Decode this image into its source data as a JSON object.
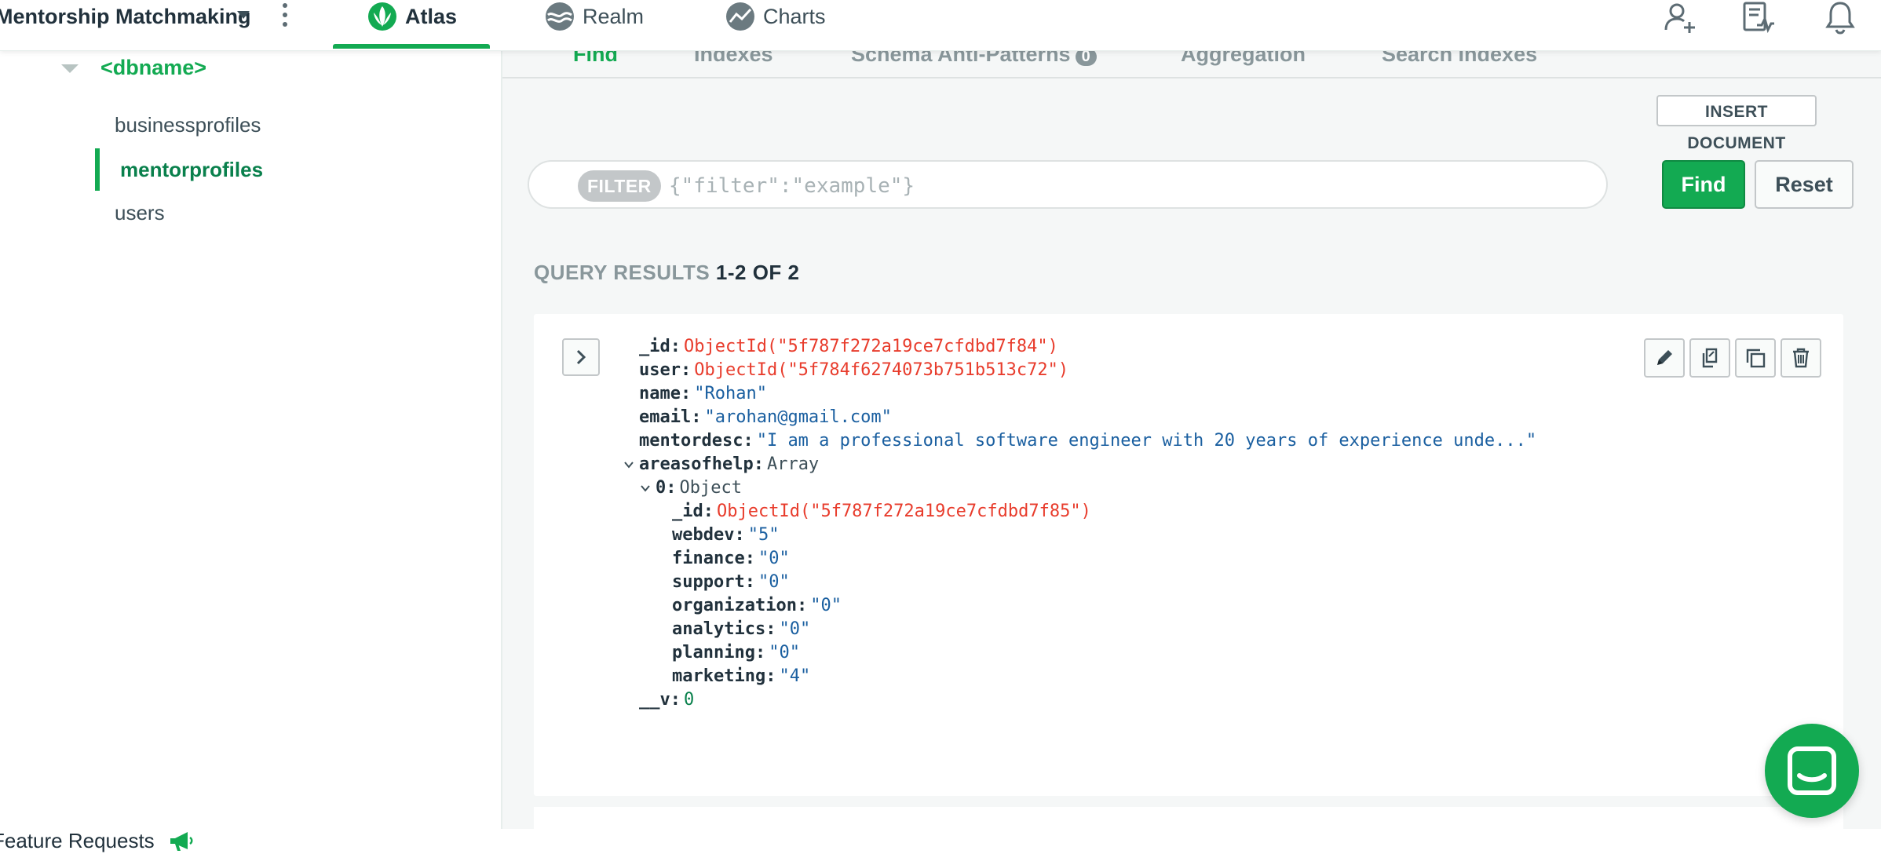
{
  "topbar": {
    "project_name": "Mentorship Matchmaking",
    "tabs": [
      {
        "label": "Atlas",
        "icon": "atlas-leaf-icon"
      },
      {
        "label": "Realm",
        "icon": "realm-icon"
      },
      {
        "label": "Charts",
        "icon": "charts-icon"
      }
    ],
    "icons": [
      "add-user-icon",
      "activity-feed-icon",
      "bell-icon"
    ],
    "accent": "#13aa52"
  },
  "sidebar": {
    "db_name": "<dbname>",
    "collections": [
      "businessprofiles",
      "mentorprofiles",
      "users"
    ],
    "active_collection": "mentorprofiles",
    "feature_requests": "Feature Requests"
  },
  "main": {
    "subtabs": [
      "Find",
      "Indexes",
      "Schema Anti-Patterns",
      "Aggregation",
      "Search Indexes"
    ],
    "schema_badge": "0",
    "insert_label": "INSERT DOCUMENT",
    "filter_pill": "FILTER",
    "filter_placeholder": "{\"filter\":\"example\"}",
    "find_label": "Find",
    "reset_label": "Reset",
    "results_label": "QUERY RESULTS",
    "results_count": "1-2 OF 2"
  },
  "document": [
    {
      "key": "_id",
      "value": "ObjectId(\"5f787f272a19ce7cfdbd7f84\")",
      "kind": "objectid"
    },
    {
      "key": "user",
      "value": "ObjectId(\"5f784f6274073b751b513c72\")",
      "kind": "objectid"
    },
    {
      "key": "name",
      "value": "\"Rohan\"",
      "kind": "string"
    },
    {
      "key": "email",
      "value": "\"arohan@gmail.com\"",
      "kind": "string"
    },
    {
      "key": "mentordesc",
      "value": "\"I am a professional software engineer with 20 years of experience unde...\"",
      "kind": "string"
    },
    {
      "key": "areasofhelp",
      "value": "Array",
      "kind": "type"
    },
    {
      "key": "0",
      "value": "Object",
      "kind": "type"
    },
    {
      "key": "_id",
      "value": "ObjectId(\"5f787f272a19ce7cfdbd7f85\")",
      "kind": "objectid"
    },
    {
      "key": "webdev",
      "value": "\"5\"",
      "kind": "string"
    },
    {
      "key": "finance",
      "value": "\"0\"",
      "kind": "string"
    },
    {
      "key": "support",
      "value": "\"0\"",
      "kind": "string"
    },
    {
      "key": "organization",
      "value": "\"0\"",
      "kind": "string"
    },
    {
      "key": "analytics",
      "value": "\"0\"",
      "kind": "string"
    },
    {
      "key": "planning",
      "value": "\"0\"",
      "kind": "string"
    },
    {
      "key": "marketing",
      "value": "\"4\"",
      "kind": "string"
    },
    {
      "key": "__v",
      "value": "0",
      "kind": "number"
    }
  ]
}
